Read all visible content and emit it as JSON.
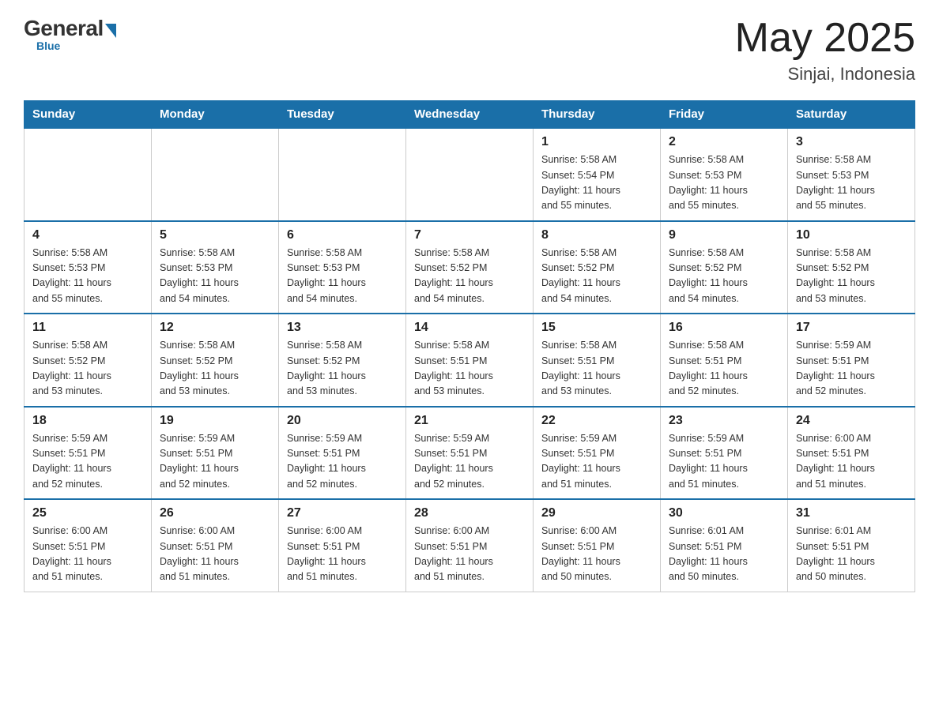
{
  "logo": {
    "general": "General",
    "blue": "Blue",
    "tagline": "Blue"
  },
  "header": {
    "month_year": "May 2025",
    "location": "Sinjai, Indonesia"
  },
  "days_of_week": [
    "Sunday",
    "Monday",
    "Tuesday",
    "Wednesday",
    "Thursday",
    "Friday",
    "Saturday"
  ],
  "weeks": [
    {
      "days": [
        {
          "number": "",
          "info": ""
        },
        {
          "number": "",
          "info": ""
        },
        {
          "number": "",
          "info": ""
        },
        {
          "number": "",
          "info": ""
        },
        {
          "number": "1",
          "info": "Sunrise: 5:58 AM\nSunset: 5:54 PM\nDaylight: 11 hours\nand 55 minutes."
        },
        {
          "number": "2",
          "info": "Sunrise: 5:58 AM\nSunset: 5:53 PM\nDaylight: 11 hours\nand 55 minutes."
        },
        {
          "number": "3",
          "info": "Sunrise: 5:58 AM\nSunset: 5:53 PM\nDaylight: 11 hours\nand 55 minutes."
        }
      ]
    },
    {
      "days": [
        {
          "number": "4",
          "info": "Sunrise: 5:58 AM\nSunset: 5:53 PM\nDaylight: 11 hours\nand 55 minutes."
        },
        {
          "number": "5",
          "info": "Sunrise: 5:58 AM\nSunset: 5:53 PM\nDaylight: 11 hours\nand 54 minutes."
        },
        {
          "number": "6",
          "info": "Sunrise: 5:58 AM\nSunset: 5:53 PM\nDaylight: 11 hours\nand 54 minutes."
        },
        {
          "number": "7",
          "info": "Sunrise: 5:58 AM\nSunset: 5:52 PM\nDaylight: 11 hours\nand 54 minutes."
        },
        {
          "number": "8",
          "info": "Sunrise: 5:58 AM\nSunset: 5:52 PM\nDaylight: 11 hours\nand 54 minutes."
        },
        {
          "number": "9",
          "info": "Sunrise: 5:58 AM\nSunset: 5:52 PM\nDaylight: 11 hours\nand 54 minutes."
        },
        {
          "number": "10",
          "info": "Sunrise: 5:58 AM\nSunset: 5:52 PM\nDaylight: 11 hours\nand 53 minutes."
        }
      ]
    },
    {
      "days": [
        {
          "number": "11",
          "info": "Sunrise: 5:58 AM\nSunset: 5:52 PM\nDaylight: 11 hours\nand 53 minutes."
        },
        {
          "number": "12",
          "info": "Sunrise: 5:58 AM\nSunset: 5:52 PM\nDaylight: 11 hours\nand 53 minutes."
        },
        {
          "number": "13",
          "info": "Sunrise: 5:58 AM\nSunset: 5:52 PM\nDaylight: 11 hours\nand 53 minutes."
        },
        {
          "number": "14",
          "info": "Sunrise: 5:58 AM\nSunset: 5:51 PM\nDaylight: 11 hours\nand 53 minutes."
        },
        {
          "number": "15",
          "info": "Sunrise: 5:58 AM\nSunset: 5:51 PM\nDaylight: 11 hours\nand 53 minutes."
        },
        {
          "number": "16",
          "info": "Sunrise: 5:58 AM\nSunset: 5:51 PM\nDaylight: 11 hours\nand 52 minutes."
        },
        {
          "number": "17",
          "info": "Sunrise: 5:59 AM\nSunset: 5:51 PM\nDaylight: 11 hours\nand 52 minutes."
        }
      ]
    },
    {
      "days": [
        {
          "number": "18",
          "info": "Sunrise: 5:59 AM\nSunset: 5:51 PM\nDaylight: 11 hours\nand 52 minutes."
        },
        {
          "number": "19",
          "info": "Sunrise: 5:59 AM\nSunset: 5:51 PM\nDaylight: 11 hours\nand 52 minutes."
        },
        {
          "number": "20",
          "info": "Sunrise: 5:59 AM\nSunset: 5:51 PM\nDaylight: 11 hours\nand 52 minutes."
        },
        {
          "number": "21",
          "info": "Sunrise: 5:59 AM\nSunset: 5:51 PM\nDaylight: 11 hours\nand 52 minutes."
        },
        {
          "number": "22",
          "info": "Sunrise: 5:59 AM\nSunset: 5:51 PM\nDaylight: 11 hours\nand 51 minutes."
        },
        {
          "number": "23",
          "info": "Sunrise: 5:59 AM\nSunset: 5:51 PM\nDaylight: 11 hours\nand 51 minutes."
        },
        {
          "number": "24",
          "info": "Sunrise: 6:00 AM\nSunset: 5:51 PM\nDaylight: 11 hours\nand 51 minutes."
        }
      ]
    },
    {
      "days": [
        {
          "number": "25",
          "info": "Sunrise: 6:00 AM\nSunset: 5:51 PM\nDaylight: 11 hours\nand 51 minutes."
        },
        {
          "number": "26",
          "info": "Sunrise: 6:00 AM\nSunset: 5:51 PM\nDaylight: 11 hours\nand 51 minutes."
        },
        {
          "number": "27",
          "info": "Sunrise: 6:00 AM\nSunset: 5:51 PM\nDaylight: 11 hours\nand 51 minutes."
        },
        {
          "number": "28",
          "info": "Sunrise: 6:00 AM\nSunset: 5:51 PM\nDaylight: 11 hours\nand 51 minutes."
        },
        {
          "number": "29",
          "info": "Sunrise: 6:00 AM\nSunset: 5:51 PM\nDaylight: 11 hours\nand 50 minutes."
        },
        {
          "number": "30",
          "info": "Sunrise: 6:01 AM\nSunset: 5:51 PM\nDaylight: 11 hours\nand 50 minutes."
        },
        {
          "number": "31",
          "info": "Sunrise: 6:01 AM\nSunset: 5:51 PM\nDaylight: 11 hours\nand 50 minutes."
        }
      ]
    }
  ]
}
